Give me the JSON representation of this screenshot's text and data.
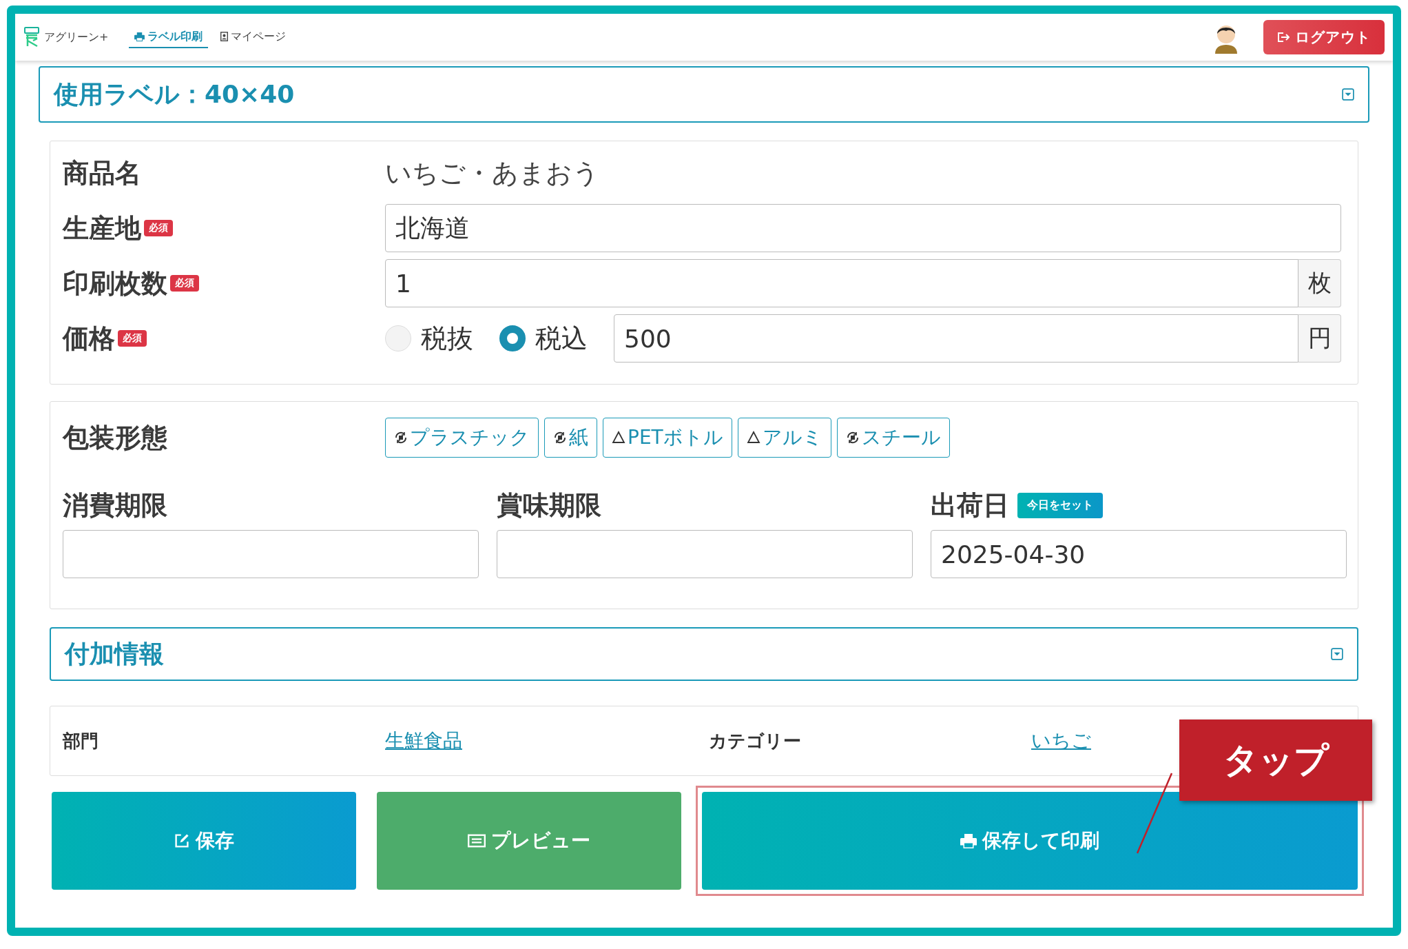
{
  "header": {
    "logo_text": "アグリーン+",
    "nav": [
      {
        "label": "ラベル印刷",
        "selected": true,
        "kind": "printer"
      },
      {
        "label": "マイページ",
        "selected": false,
        "kind": "badge"
      }
    ],
    "logout": "ログアウト"
  },
  "label_bar": {
    "title": "使用ラベル：40×40",
    "expanded": false
  },
  "form_rows": [
    {
      "kind": "static",
      "label": "商品名",
      "value": "いちご・あまおう"
    },
    {
      "kind": "text",
      "label": "生産地",
      "badge": "必須",
      "value": "北海道"
    },
    {
      "kind": "unit",
      "label": "印刷枚数",
      "badge": "必須",
      "value": "1",
      "unit": "枚"
    },
    {
      "kind": "price",
      "label": "価格",
      "badge": "必須",
      "options": [
        {
          "label": "税抜",
          "selected": false
        },
        {
          "label": "税込",
          "selected": true
        }
      ],
      "value": "500",
      "unit": "円"
    }
  ],
  "packaging": {
    "label": "包装形態",
    "options": [
      {
        "kind": "plastic",
        "label": "プラスチック"
      },
      {
        "kind": "paper",
        "label": "紙"
      },
      {
        "kind": "pet",
        "label": "PETボトル"
      },
      {
        "kind": "aluminum",
        "label": "アルミ"
      },
      {
        "kind": "steel",
        "label": "スチール"
      }
    ]
  },
  "dates": [
    {
      "label": "消費期限"
    },
    {
      "label": "賞味期限"
    },
    {
      "label": "出荷日",
      "button": "今日をセット",
      "value": "2025-04-30"
    }
  ],
  "additional": {
    "title": "付加情報",
    "expanded": false
  },
  "categories": [
    {
      "label": "部門",
      "link": "生鮮食品"
    },
    {
      "label": "カテゴリー",
      "link": "いちご"
    }
  ],
  "buttons": [
    {
      "kind": "save",
      "label": "保存",
      "highlighted": false
    },
    {
      "kind": "preview",
      "label": "プレビュー",
      "highlighted": false
    },
    {
      "kind": "print",
      "label": "保存して印刷",
      "highlighted": true
    }
  ],
  "callout": {
    "label": "タップ"
  }
}
